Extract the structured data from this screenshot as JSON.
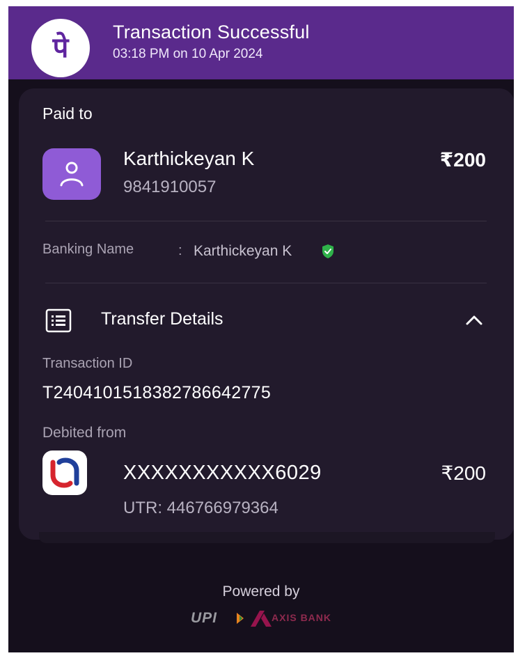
{
  "header": {
    "logo_glyph": "पे",
    "title": "Transaction Successful",
    "subtitle": "03:18 PM on 10 Apr 2024",
    "bg_color": "#5a2a8c"
  },
  "payment": {
    "paid_to_label": "Paid to",
    "payee_name": "Karthickeyan K",
    "payee_phone": "9841910057",
    "amount": "₹200",
    "avatar_icon": "user-icon",
    "banking_name_label": "Banking Name",
    "banking_name_sep": ":",
    "banking_name_value": "Karthickeyan  K",
    "verified_icon": "shield-check-icon",
    "verified_color": "#2fb24a"
  },
  "transfer": {
    "section_label": "Transfer Details",
    "section_icon": "receipt-list-icon",
    "toggle_icon": "chevron-up-icon",
    "txn_id_label": "Transaction ID",
    "txn_id_value": "T2404101518382786642775",
    "debited_label": "Debited from",
    "account_masked": "XXXXXXXXXXX6029",
    "debit_amount": "₹200",
    "utr": "UTR: 446766979364",
    "bank_logo_icon": "union-bank-logo"
  },
  "footer": {
    "powered_by": "Powered by",
    "upi_brand": "UPI",
    "axis_brand": "AXIS BANK"
  }
}
